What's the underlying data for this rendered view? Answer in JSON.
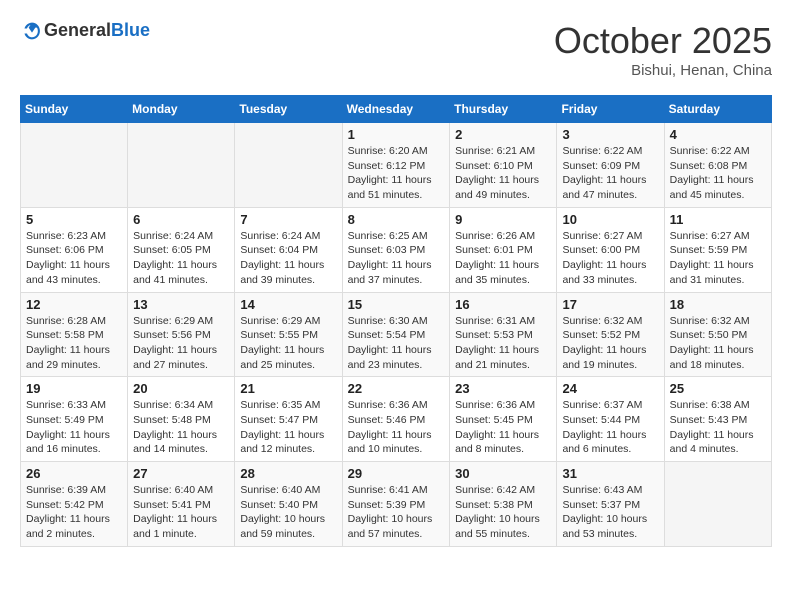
{
  "header": {
    "logo": {
      "general": "General",
      "blue": "Blue"
    },
    "title": "October 2025",
    "location": "Bishui, Henan, China"
  },
  "calendar": {
    "weekdays": [
      "Sunday",
      "Monday",
      "Tuesday",
      "Wednesday",
      "Thursday",
      "Friday",
      "Saturday"
    ],
    "weeks": [
      [
        {
          "day": "",
          "info": ""
        },
        {
          "day": "",
          "info": ""
        },
        {
          "day": "",
          "info": ""
        },
        {
          "day": "1",
          "info": "Sunrise: 6:20 AM\nSunset: 6:12 PM\nDaylight: 11 hours\nand 51 minutes."
        },
        {
          "day": "2",
          "info": "Sunrise: 6:21 AM\nSunset: 6:10 PM\nDaylight: 11 hours\nand 49 minutes."
        },
        {
          "day": "3",
          "info": "Sunrise: 6:22 AM\nSunset: 6:09 PM\nDaylight: 11 hours\nand 47 minutes."
        },
        {
          "day": "4",
          "info": "Sunrise: 6:22 AM\nSunset: 6:08 PM\nDaylight: 11 hours\nand 45 minutes."
        }
      ],
      [
        {
          "day": "5",
          "info": "Sunrise: 6:23 AM\nSunset: 6:06 PM\nDaylight: 11 hours\nand 43 minutes."
        },
        {
          "day": "6",
          "info": "Sunrise: 6:24 AM\nSunset: 6:05 PM\nDaylight: 11 hours\nand 41 minutes."
        },
        {
          "day": "7",
          "info": "Sunrise: 6:24 AM\nSunset: 6:04 PM\nDaylight: 11 hours\nand 39 minutes."
        },
        {
          "day": "8",
          "info": "Sunrise: 6:25 AM\nSunset: 6:03 PM\nDaylight: 11 hours\nand 37 minutes."
        },
        {
          "day": "9",
          "info": "Sunrise: 6:26 AM\nSunset: 6:01 PM\nDaylight: 11 hours\nand 35 minutes."
        },
        {
          "day": "10",
          "info": "Sunrise: 6:27 AM\nSunset: 6:00 PM\nDaylight: 11 hours\nand 33 minutes."
        },
        {
          "day": "11",
          "info": "Sunrise: 6:27 AM\nSunset: 5:59 PM\nDaylight: 11 hours\nand 31 minutes."
        }
      ],
      [
        {
          "day": "12",
          "info": "Sunrise: 6:28 AM\nSunset: 5:58 PM\nDaylight: 11 hours\nand 29 minutes."
        },
        {
          "day": "13",
          "info": "Sunrise: 6:29 AM\nSunset: 5:56 PM\nDaylight: 11 hours\nand 27 minutes."
        },
        {
          "day": "14",
          "info": "Sunrise: 6:29 AM\nSunset: 5:55 PM\nDaylight: 11 hours\nand 25 minutes."
        },
        {
          "day": "15",
          "info": "Sunrise: 6:30 AM\nSunset: 5:54 PM\nDaylight: 11 hours\nand 23 minutes."
        },
        {
          "day": "16",
          "info": "Sunrise: 6:31 AM\nSunset: 5:53 PM\nDaylight: 11 hours\nand 21 minutes."
        },
        {
          "day": "17",
          "info": "Sunrise: 6:32 AM\nSunset: 5:52 PM\nDaylight: 11 hours\nand 19 minutes."
        },
        {
          "day": "18",
          "info": "Sunrise: 6:32 AM\nSunset: 5:50 PM\nDaylight: 11 hours\nand 18 minutes."
        }
      ],
      [
        {
          "day": "19",
          "info": "Sunrise: 6:33 AM\nSunset: 5:49 PM\nDaylight: 11 hours\nand 16 minutes."
        },
        {
          "day": "20",
          "info": "Sunrise: 6:34 AM\nSunset: 5:48 PM\nDaylight: 11 hours\nand 14 minutes."
        },
        {
          "day": "21",
          "info": "Sunrise: 6:35 AM\nSunset: 5:47 PM\nDaylight: 11 hours\nand 12 minutes."
        },
        {
          "day": "22",
          "info": "Sunrise: 6:36 AM\nSunset: 5:46 PM\nDaylight: 11 hours\nand 10 minutes."
        },
        {
          "day": "23",
          "info": "Sunrise: 6:36 AM\nSunset: 5:45 PM\nDaylight: 11 hours\nand 8 minutes."
        },
        {
          "day": "24",
          "info": "Sunrise: 6:37 AM\nSunset: 5:44 PM\nDaylight: 11 hours\nand 6 minutes."
        },
        {
          "day": "25",
          "info": "Sunrise: 6:38 AM\nSunset: 5:43 PM\nDaylight: 11 hours\nand 4 minutes."
        }
      ],
      [
        {
          "day": "26",
          "info": "Sunrise: 6:39 AM\nSunset: 5:42 PM\nDaylight: 11 hours\nand 2 minutes."
        },
        {
          "day": "27",
          "info": "Sunrise: 6:40 AM\nSunset: 5:41 PM\nDaylight: 11 hours\nand 1 minute."
        },
        {
          "day": "28",
          "info": "Sunrise: 6:40 AM\nSunset: 5:40 PM\nDaylight: 10 hours\nand 59 minutes."
        },
        {
          "day": "29",
          "info": "Sunrise: 6:41 AM\nSunset: 5:39 PM\nDaylight: 10 hours\nand 57 minutes."
        },
        {
          "day": "30",
          "info": "Sunrise: 6:42 AM\nSunset: 5:38 PM\nDaylight: 10 hours\nand 55 minutes."
        },
        {
          "day": "31",
          "info": "Sunrise: 6:43 AM\nSunset: 5:37 PM\nDaylight: 10 hours\nand 53 minutes."
        },
        {
          "day": "",
          "info": ""
        }
      ]
    ]
  }
}
